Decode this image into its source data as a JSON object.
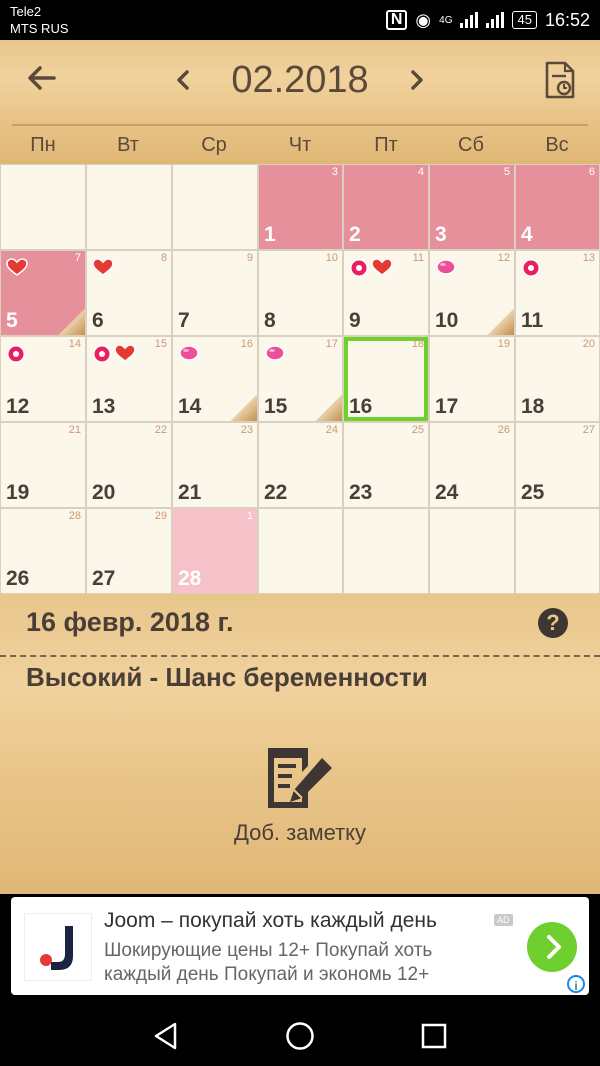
{
  "status": {
    "carrier1": "Tele2",
    "carrier2": "MTS RUS",
    "network": "4G",
    "battery": "45",
    "time": "16:52"
  },
  "header": {
    "month": "02.2018",
    "prev_icon": "chevron-left-icon",
    "next_icon": "chevron-right-icon",
    "back_icon": "arrow-left-icon",
    "report_icon": "document-icon"
  },
  "weekdays": [
    "Пн",
    "Вт",
    "Ср",
    "Чт",
    "Пт",
    "Сб",
    "Вс"
  ],
  "calendar": {
    "cells": [
      {
        "day": "",
        "small": "",
        "state": "empty",
        "icons": [],
        "fold": false
      },
      {
        "day": "",
        "small": "",
        "state": "empty",
        "icons": [],
        "fold": false
      },
      {
        "day": "",
        "small": "",
        "state": "empty",
        "icons": [],
        "fold": false
      },
      {
        "day": "1",
        "small": "3",
        "state": "period",
        "icons": [],
        "fold": false
      },
      {
        "day": "2",
        "small": "4",
        "state": "period",
        "icons": [],
        "fold": false
      },
      {
        "day": "3",
        "small": "5",
        "state": "period",
        "icons": [],
        "fold": false
      },
      {
        "day": "4",
        "small": "6",
        "state": "period",
        "icons": [],
        "fold": false
      },
      {
        "day": "5",
        "small": "7",
        "state": "period",
        "icons": [
          "heart"
        ],
        "fold": true
      },
      {
        "day": "6",
        "small": "8",
        "state": "normal",
        "icons": [
          "heart"
        ],
        "fold": false
      },
      {
        "day": "7",
        "small": "9",
        "state": "normal",
        "icons": [],
        "fold": false
      },
      {
        "day": "8",
        "small": "10",
        "state": "normal",
        "icons": [],
        "fold": false
      },
      {
        "day": "9",
        "small": "11",
        "state": "normal",
        "icons": [
          "flower",
          "heart"
        ],
        "fold": false
      },
      {
        "day": "10",
        "small": "12",
        "state": "normal",
        "icons": [
          "egg"
        ],
        "fold": true
      },
      {
        "day": "11",
        "small": "13",
        "state": "normal",
        "icons": [
          "flower"
        ],
        "fold": false
      },
      {
        "day": "12",
        "small": "14",
        "state": "normal",
        "icons": [
          "flower"
        ],
        "fold": false
      },
      {
        "day": "13",
        "small": "15",
        "state": "normal",
        "icons": [
          "flower",
          "heart"
        ],
        "fold": false
      },
      {
        "day": "14",
        "small": "16",
        "state": "normal",
        "icons": [
          "egg"
        ],
        "fold": true
      },
      {
        "day": "15",
        "small": "17",
        "state": "normal",
        "icons": [
          "egg"
        ],
        "fold": true
      },
      {
        "day": "16",
        "small": "18",
        "state": "today",
        "icons": [],
        "fold": false
      },
      {
        "day": "17",
        "small": "19",
        "state": "normal",
        "icons": [],
        "fold": false
      },
      {
        "day": "18",
        "small": "20",
        "state": "normal",
        "icons": [],
        "fold": false
      },
      {
        "day": "19",
        "small": "21",
        "state": "normal",
        "icons": [],
        "fold": false
      },
      {
        "day": "20",
        "small": "22",
        "state": "normal",
        "icons": [],
        "fold": false
      },
      {
        "day": "21",
        "small": "23",
        "state": "normal",
        "icons": [],
        "fold": false
      },
      {
        "day": "22",
        "small": "24",
        "state": "normal",
        "icons": [],
        "fold": false
      },
      {
        "day": "23",
        "small": "25",
        "state": "normal",
        "icons": [],
        "fold": false
      },
      {
        "day": "24",
        "small": "26",
        "state": "normal",
        "icons": [],
        "fold": false
      },
      {
        "day": "25",
        "small": "27",
        "state": "normal",
        "icons": [],
        "fold": false
      },
      {
        "day": "26",
        "small": "28",
        "state": "normal",
        "icons": [],
        "fold": false
      },
      {
        "day": "27",
        "small": "29",
        "state": "normal",
        "icons": [],
        "fold": false
      },
      {
        "day": "28",
        "small": "1",
        "state": "pred",
        "icons": [],
        "fold": false
      },
      {
        "day": "",
        "small": "",
        "state": "empty",
        "icons": [],
        "fold": false
      },
      {
        "day": "",
        "small": "",
        "state": "empty",
        "icons": [],
        "fold": false
      },
      {
        "day": "",
        "small": "",
        "state": "empty",
        "icons": [],
        "fold": false
      },
      {
        "day": "",
        "small": "",
        "state": "empty",
        "icons": [],
        "fold": false
      }
    ]
  },
  "info": {
    "date": "16 февр. 2018 г.",
    "help": "?",
    "chance": "Высокий - Шанс беременности",
    "add_note": "Доб. заметку",
    "note_icon": "edit-note-icon"
  },
  "ad": {
    "title": "Joom – покупай хоть каждый день",
    "tag": "AD",
    "description": "Шокирующие цены 12+ Покупай хоть каждый день Покупай и экономь 12+",
    "info": "i"
  },
  "colors": {
    "period": "#e5909a",
    "predicted": "#f7c1c9",
    "today_border": "#6fd12c",
    "text_dark": "#4a3f37"
  }
}
